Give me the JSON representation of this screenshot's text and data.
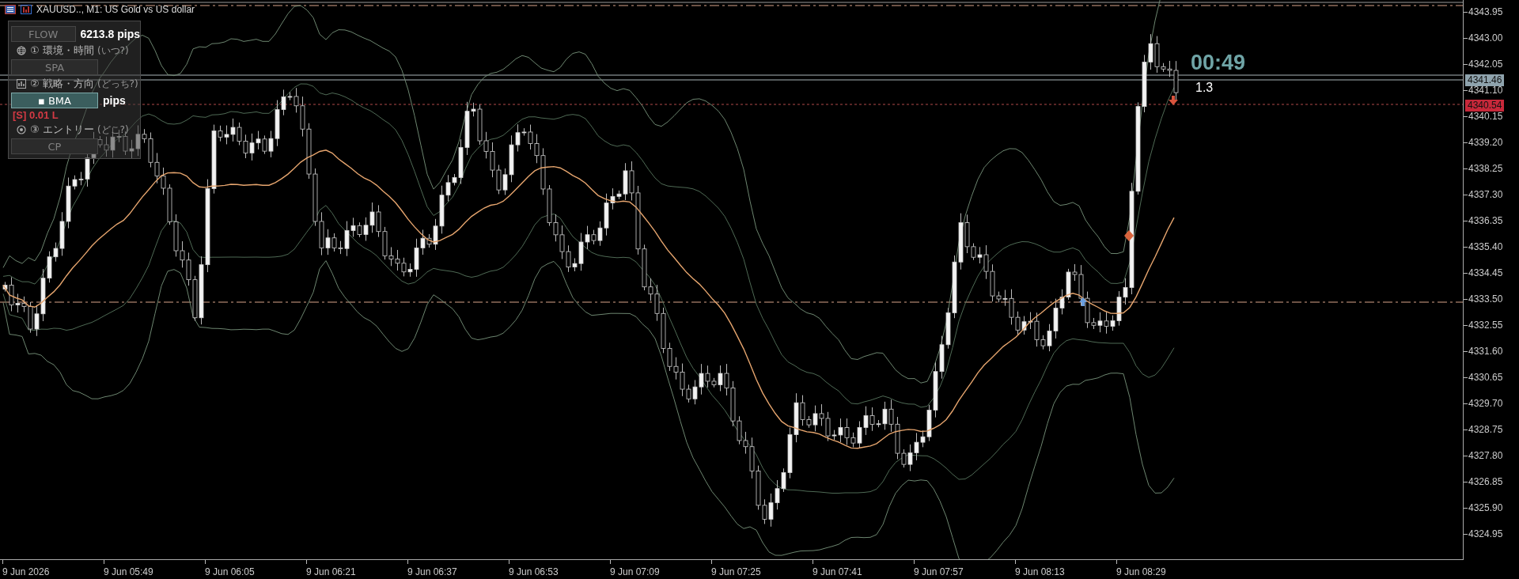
{
  "chart_header": {
    "symbol": "XAUUSD.., M1:",
    "description": "US Gold vs US dollar"
  },
  "panel": {
    "items": [
      {
        "kind": "button",
        "label": "FLOW",
        "selected": false,
        "value": "6213.8 pips"
      },
      {
        "kind": "heading",
        "number": "①",
        "title": "環境・時間",
        "hint": "(いつ?)"
      },
      {
        "kind": "button",
        "label": "SPA",
        "selected": false
      },
      {
        "kind": "heading",
        "number": "②",
        "title": "戦略・方向",
        "hint": "(どっち?)"
      },
      {
        "kind": "button",
        "label": "▪ BMA",
        "selected": true,
        "value": "pips"
      },
      {
        "kind": "note",
        "text": "[S] 0.01 L"
      },
      {
        "kind": "heading",
        "number": "③",
        "title": "エントリー",
        "hint": "(どこ?)"
      },
      {
        "kind": "button",
        "label": "CP",
        "selected": false
      }
    ]
  },
  "timer": {
    "countdown": "00:49",
    "spread": "1.3"
  },
  "price_axis": {
    "labels": [
      "4343.95",
      "4343.00",
      "4342.05",
      "4341.10",
      "4340.15",
      "4339.20",
      "4338.25",
      "4337.30",
      "4336.35",
      "4335.40",
      "4334.45",
      "4333.50",
      "4332.55",
      "4331.60",
      "4330.65",
      "4329.70",
      "4328.75",
      "4327.80",
      "4326.85",
      "4325.90",
      "4324.95"
    ]
  },
  "price_tags": [
    {
      "text": "4341.46",
      "color": "#8fa3ad"
    },
    {
      "text": "4340.54",
      "color": "#c8283a"
    }
  ],
  "time_axis": {
    "labels": [
      "9 Jun 2026",
      "9 Jun 05:49",
      "9 Jun 06:05",
      "9 Jun 06:21",
      "9 Jun 06:37",
      "9 Jun 06:53",
      "9 Jun 07:09",
      "9 Jun 07:25",
      "9 Jun 07:41",
      "9 Jun 07:57",
      "9 Jun 08:13",
      "9 Jun 08:29"
    ]
  }
}
